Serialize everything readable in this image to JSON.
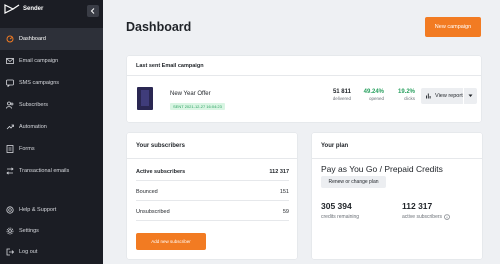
{
  "app": {
    "name": "Sender"
  },
  "sidebar": {
    "items": [
      {
        "label": "Dashboard",
        "icon": "dashboard-icon"
      },
      {
        "label": "Email campaign",
        "icon": "mail-icon"
      },
      {
        "label": "SMS campaigns",
        "icon": "sms-icon"
      },
      {
        "label": "Subscribers",
        "icon": "users-icon"
      },
      {
        "label": "Automation",
        "icon": "automation-icon"
      },
      {
        "label": "Forms",
        "icon": "forms-icon"
      },
      {
        "label": "Transactional emails",
        "icon": "transactional-icon"
      }
    ],
    "bottom_items": [
      {
        "label": "Help & Support",
        "icon": "help-icon"
      },
      {
        "label": "Settings",
        "icon": "gear-icon"
      },
      {
        "label": "Log out",
        "icon": "logout-icon"
      }
    ]
  },
  "header": {
    "title": "Dashboard",
    "new_campaign_label": "New campaign"
  },
  "last_campaign": {
    "heading": "Last sent Email campaign",
    "name": "New Year Offer",
    "sent_badge": "SENT 2021-12-27 16:04:23",
    "stats": [
      {
        "value": "51 811",
        "label": "delivered"
      },
      {
        "value": "49.24%",
        "label": "opened"
      },
      {
        "value": "19.2%",
        "label": "clicks"
      }
    ],
    "view_report_label": "View report"
  },
  "subscribers": {
    "heading": "Your subscribers",
    "rows": [
      {
        "label": "Active subscribers",
        "value": "112 317"
      },
      {
        "label": "Bounced",
        "value": "151"
      },
      {
        "label": "Unsubscribed",
        "value": "59"
      }
    ],
    "add_button_label": "Add new subscriber"
  },
  "plan": {
    "heading": "Your plan",
    "name": "Pay as You Go / Prepaid Credits",
    "renew_label": "Renew or change plan",
    "credits_value": "305 394",
    "credits_label": "credits remaining",
    "active_value": "112 317",
    "active_label": "active subscribers"
  },
  "colors": {
    "accent": "#f27b22",
    "sidebar_bg": "#1b1d24",
    "success": "#2aa160"
  }
}
